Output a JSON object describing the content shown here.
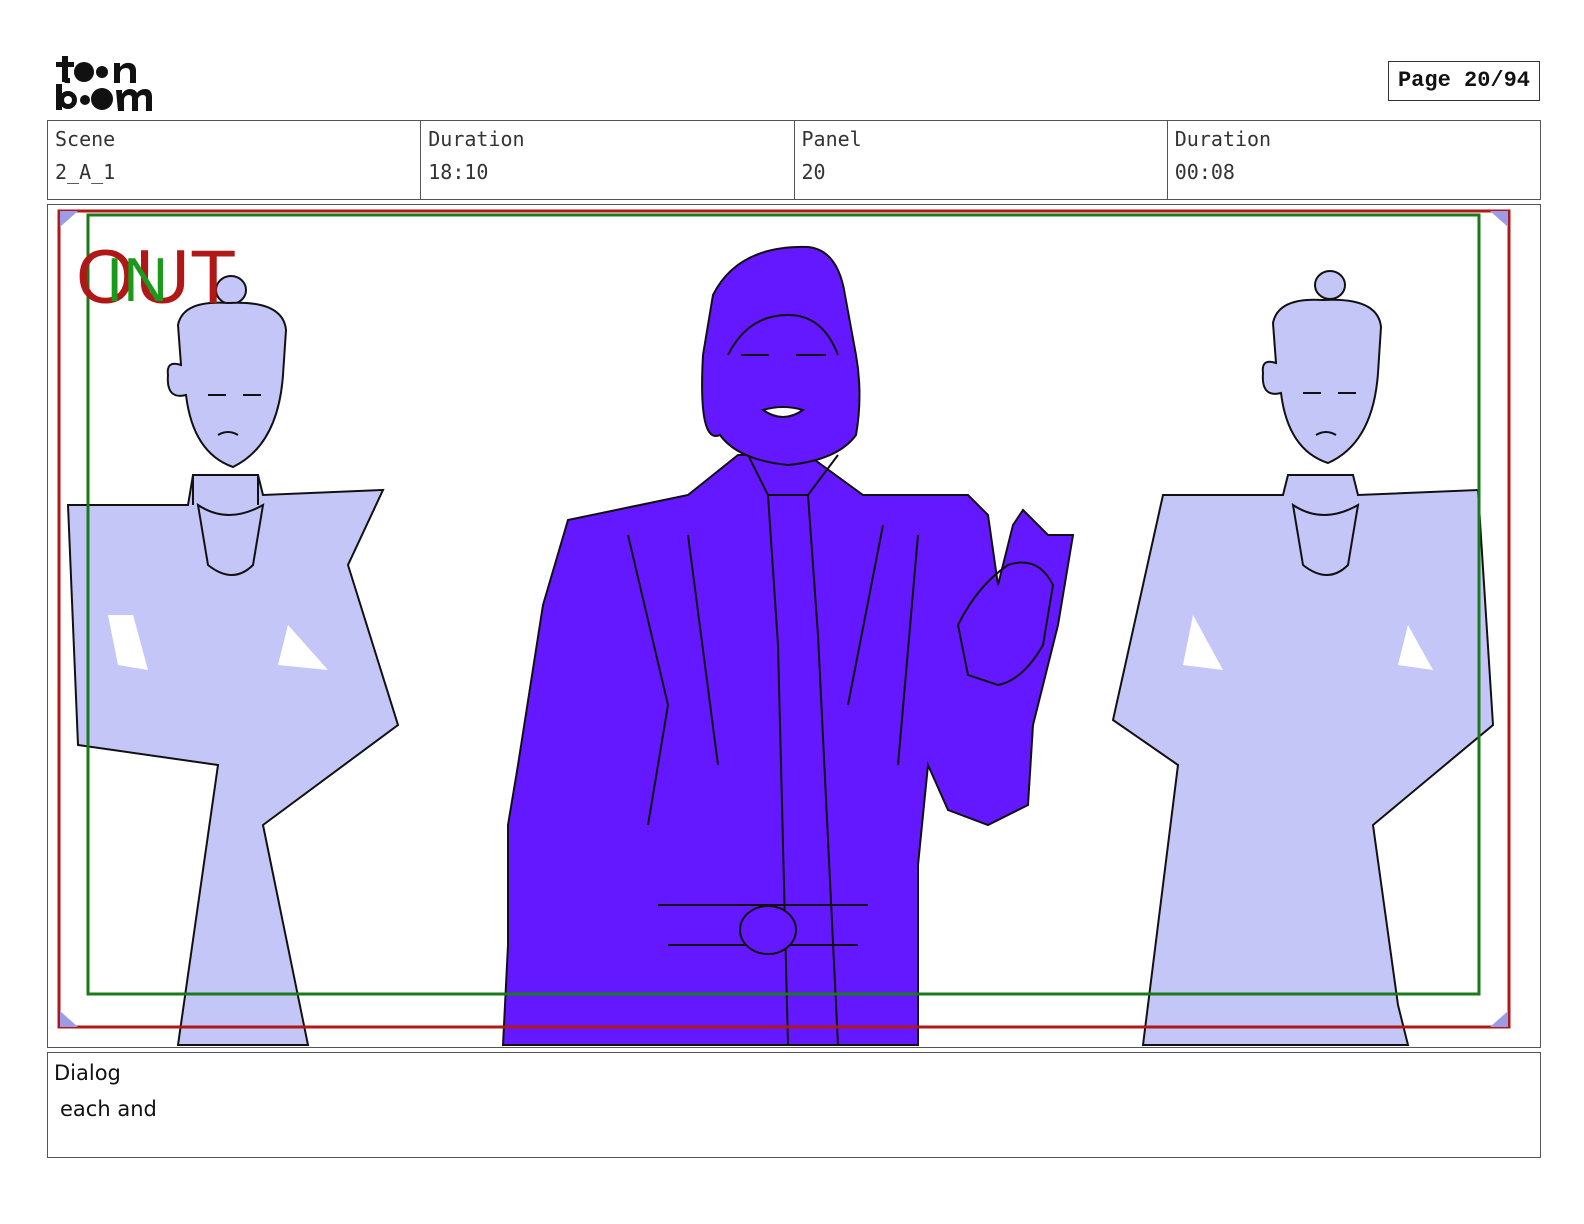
{
  "header": {
    "logo_text": "toon boom",
    "page_label": "Page 20/94"
  },
  "info": {
    "scene_label": "Scene",
    "scene_value": "2_A_1",
    "duration_label": "Duration",
    "duration_value": "18:10",
    "panel_label": "Panel",
    "panel_value": "20",
    "panel_duration_label": "Duration",
    "panel_duration_value": "00:08"
  },
  "panel_image": {
    "out_marker": "OUT",
    "in_marker": "IN",
    "colors": {
      "out_frame": "#b01818",
      "in_frame": "#1a7a1a",
      "main_character": "#6418ff",
      "side_character": "#c5c6f8",
      "outline": "#111111"
    }
  },
  "dialog": {
    "label": "Dialog",
    "text": "each and"
  }
}
